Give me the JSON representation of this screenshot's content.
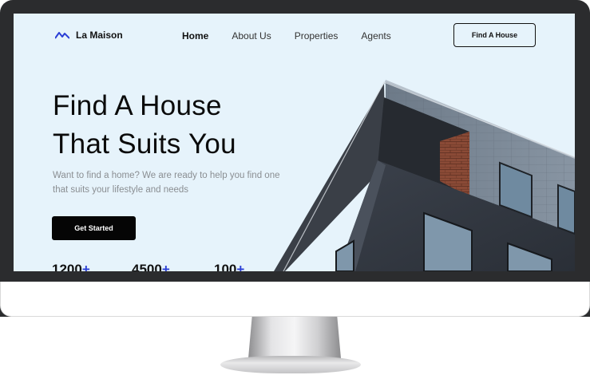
{
  "brand": {
    "name": "La Maison",
    "logo_icon": "mountain-logo-icon"
  },
  "nav": {
    "items": [
      "Home",
      "About Us",
      "Properties",
      "Agents"
    ],
    "active": "Home",
    "cta_label": "Find A House"
  },
  "hero": {
    "title_line1": "Find A House",
    "title_line2": "That Suits You",
    "subtitle": "Want to find a home? We are ready to help you find one that suits your lifestyle and needs",
    "button_label": "Get Started"
  },
  "stats": [
    {
      "value": "1200",
      "suffix": "+"
    },
    {
      "value": "4500",
      "suffix": "+"
    },
    {
      "value": "100",
      "suffix": "+"
    }
  ],
  "colors": {
    "background": "#e6f3fb",
    "accent": "#2b3fd6",
    "dark": "#050505"
  }
}
